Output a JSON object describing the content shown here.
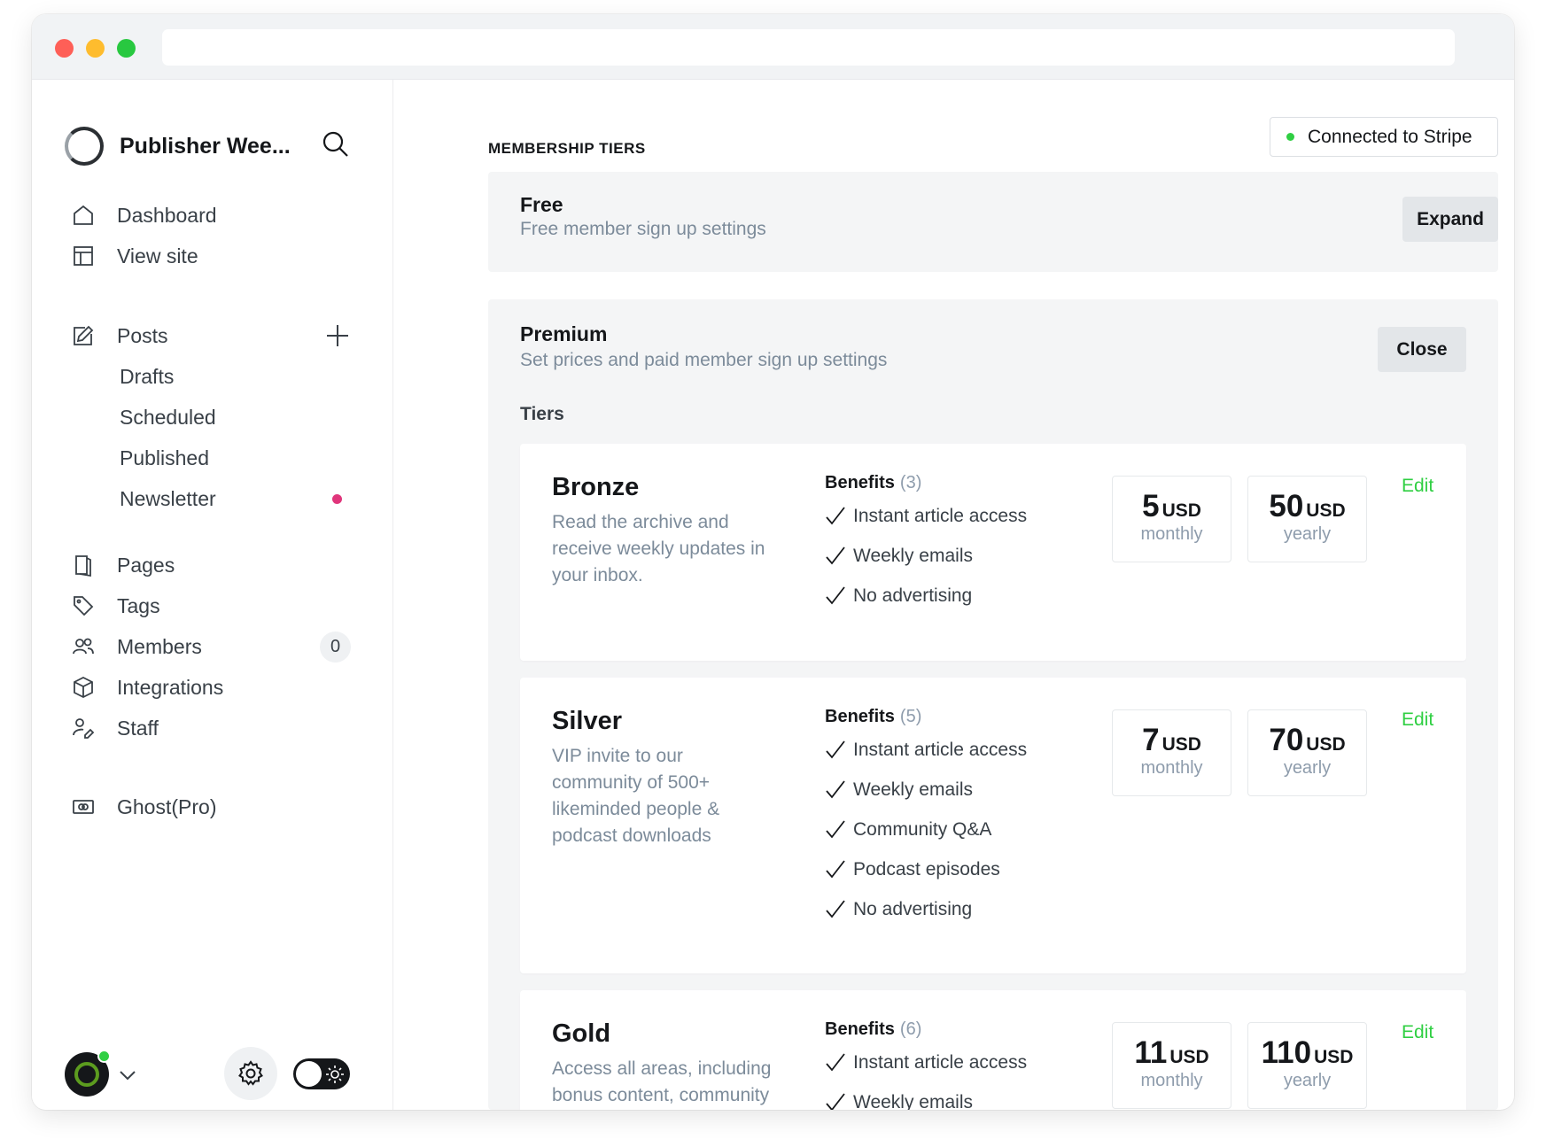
{
  "sidebar": {
    "site_name": "Publisher Wee...",
    "nav": [
      {
        "label": "Dashboard",
        "icon": "home-icon"
      },
      {
        "label": "View site",
        "icon": "layout-icon"
      }
    ],
    "posts": {
      "label": "Posts",
      "icon": "edit-icon",
      "sub": [
        "Drafts",
        "Scheduled",
        "Published",
        "Newsletter"
      ]
    },
    "nav2": [
      {
        "label": "Pages",
        "icon": "pages-icon"
      },
      {
        "label": "Tags",
        "icon": "tag-icon"
      },
      {
        "label": "Members",
        "icon": "members-icon",
        "count": "0"
      },
      {
        "label": "Integrations",
        "icon": "box-icon"
      },
      {
        "label": "Staff",
        "icon": "staff-icon"
      }
    ],
    "ghost_pro": {
      "label": "Ghost(Pro)",
      "icon": "ghost-pro-icon"
    }
  },
  "main": {
    "section_title": "MEMBERSHIP TIERS",
    "stripe_label": "Connected to Stripe",
    "free": {
      "title": "Free",
      "subtitle": "Free member sign up settings",
      "button": "Expand"
    },
    "premium": {
      "title": "Premium",
      "subtitle": "Set prices and paid member sign up settings",
      "button": "Close",
      "tiers_label": "Tiers"
    },
    "tiers": [
      {
        "name": "Bronze",
        "description": "Read the archive and receive weekly updates in your inbox.",
        "benefits_label": "Benefits",
        "benefits_count": "(3)",
        "benefits": [
          "Instant article access",
          "Weekly emails",
          "No advertising"
        ],
        "monthly": {
          "amount": "5",
          "currency": "USD",
          "period": "monthly"
        },
        "yearly": {
          "amount": "50",
          "currency": "USD",
          "period": "yearly"
        },
        "edit": "Edit"
      },
      {
        "name": "Silver",
        "description": "VIP invite to our community of 500+ likeminded people & podcast downloads",
        "benefits_label": "Benefits",
        "benefits_count": "(5)",
        "benefits": [
          "Instant article access",
          "Weekly emails",
          "Community Q&A",
          "Podcast episodes",
          "No advertising"
        ],
        "monthly": {
          "amount": "7",
          "currency": "USD",
          "period": "monthly"
        },
        "yearly": {
          "amount": "70",
          "currency": "USD",
          "period": "yearly"
        },
        "edit": "Edit"
      },
      {
        "name": "Gold",
        "description": "Access all areas, including bonus content, community and podcast",
        "benefits_label": "Benefits",
        "benefits_count": "(6)",
        "benefits": [
          "Instant article access",
          "Weekly emails"
        ],
        "monthly": {
          "amount": "11",
          "currency": "USD",
          "period": "monthly"
        },
        "yearly": {
          "amount": "110",
          "currency": "USD",
          "period": "yearly"
        },
        "edit": "Edit"
      }
    ]
  },
  "colors": {
    "accent": "#30cf43",
    "badge_pink": "#e0357b",
    "panel_bg": "#f4f5f6",
    "text_muted": "#7c8b9a"
  }
}
